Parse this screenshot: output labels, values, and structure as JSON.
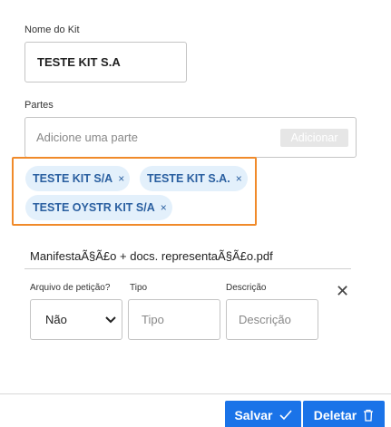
{
  "kit": {
    "name_label": "Nome do Kit",
    "name_value": "TESTE KIT S.A"
  },
  "parts": {
    "label": "Partes",
    "placeholder": "Adicione uma parte",
    "add_label": "Adicionar",
    "chips": [
      {
        "label": "TESTE KIT S/A",
        "remove": "×"
      },
      {
        "label": "TESTE KIT S.A.",
        "remove": "×"
      },
      {
        "label": "TESTE OYSTR KIT S/A",
        "remove": "×"
      }
    ]
  },
  "document": {
    "file_name": "ManifestaÃ§Ã£o + docs. representaÃ§Ã£o.pdf",
    "arquivo_label": "Arquivo de petição?",
    "arquivo_value": "Não",
    "tipo_label": "Tipo",
    "tipo_placeholder": "Tipo",
    "desc_label": "Descrição",
    "desc_placeholder": "Descrição",
    "remove": "✕"
  },
  "footer": {
    "save_label": "Salvar",
    "delete_label": "Deletar"
  },
  "colors": {
    "primary": "#1a73e8",
    "highlight": "#f08a2a",
    "chip_bg": "#e3f0fb",
    "chip_text": "#2a5fa0"
  },
  "icons": {
    "save": "check-icon",
    "delete": "trash-icon",
    "select": "chevron-down-icon"
  }
}
